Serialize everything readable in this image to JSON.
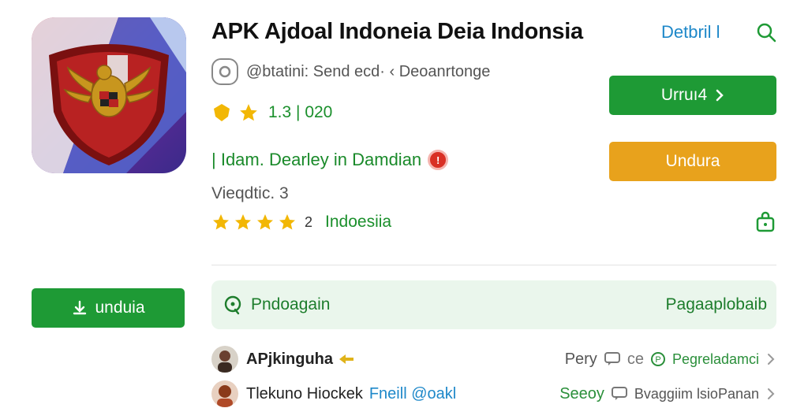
{
  "app": {
    "title": "APK Ajdoal Indoneia Deia Indonsia",
    "detail_link": "Detbril l",
    "developer": "@btatini: Send ecd· ‹ Deoanrtonge",
    "rating_text": "1.3 | 020",
    "link_text": "| Idam. Dearley in Damdian",
    "version_text": "Vieqdtic. 3",
    "stars_count": "2",
    "stars_region": "Indoesiia",
    "icon_colors": {
      "shield_red": "#b82222",
      "shield_border": "#7a1010",
      "eagle": "#c8961e"
    }
  },
  "buttons": {
    "primary": "Urruı4",
    "secondary": "Undura",
    "download": "unduia"
  },
  "banner": {
    "left": "Pndoagain",
    "right": "Pagaaplobaib"
  },
  "list": [
    {
      "name": "APjkinguha",
      "sub": "",
      "meta": "Pery",
      "green": "Pegreladamci"
    },
    {
      "name": "Tlekuno Hiockek",
      "sub": "Fneill @oakl",
      "meta": "Seeoy",
      "green": "Bvaggiim lsioPanan"
    }
  ],
  "colors": {
    "green": "#1e9a35",
    "orange": "#e8a21c",
    "blue": "#1e88c9",
    "banner_bg": "#eaf6ec"
  }
}
